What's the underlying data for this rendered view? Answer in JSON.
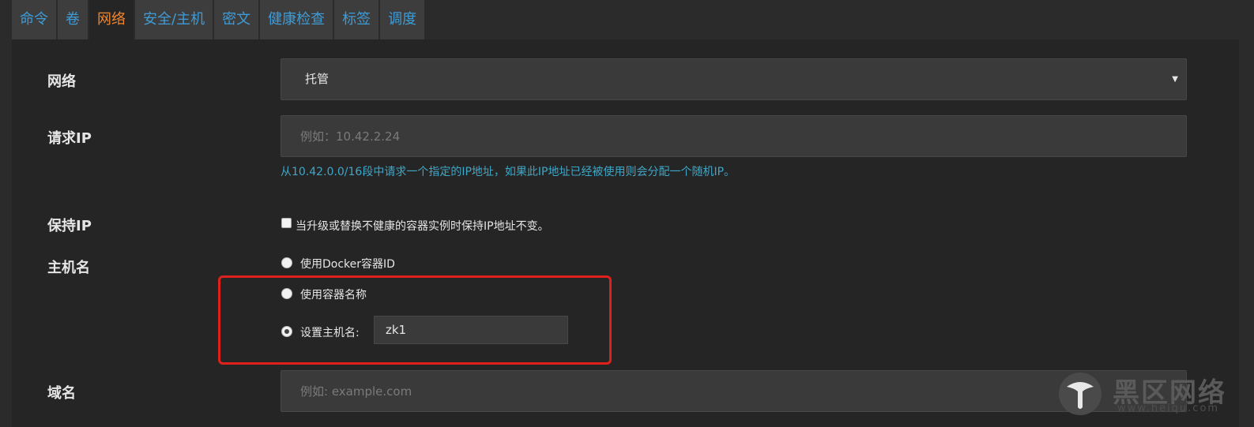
{
  "tabs": [
    {
      "label": "命令",
      "active": false
    },
    {
      "label": "卷",
      "active": false
    },
    {
      "label": "网络",
      "active": true
    },
    {
      "label": "安全/主机",
      "active": false
    },
    {
      "label": "密文",
      "active": false
    },
    {
      "label": "健康检查",
      "active": false
    },
    {
      "label": "标签",
      "active": false
    },
    {
      "label": "调度",
      "active": false
    }
  ],
  "network": {
    "label": "网络",
    "selected": "托管"
  },
  "request_ip": {
    "label": "请求IP",
    "placeholder": "例如：10.42.2.24",
    "value": "",
    "help": "从10.42.0.0/16段中请求一个指定的IP地址，如果此IP地址已经被使用则会分配一个随机IP。"
  },
  "retain_ip": {
    "label": "保持IP",
    "checkbox_text": "当升级或替换不健康的容器实例时保持IP地址不变。",
    "checked": false
  },
  "hostname": {
    "label": "主机名",
    "options": [
      {
        "label": "使用Docker容器ID",
        "checked": false
      },
      {
        "label": "使用容器名称",
        "checked": false
      },
      {
        "label": "设置主机名:",
        "checked": true
      }
    ],
    "value": "zk1"
  },
  "domain": {
    "label": "域名",
    "placeholder": "例如: example.com",
    "value": ""
  },
  "watermark": {
    "text": "黑区网络",
    "sub": "www.heiqu.com"
  },
  "colors": {
    "tab_link": "#3f9bd6",
    "tab_active": "#f0862e",
    "help_text": "#3fa7c7",
    "highlight": "#e0201c"
  }
}
